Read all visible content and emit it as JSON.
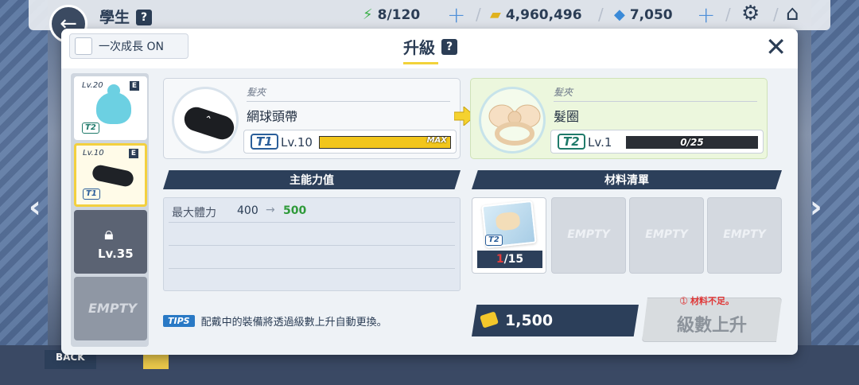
{
  "topbar": {
    "title": "學生",
    "help": "?",
    "ap": "8/120",
    "credits": "4,960,496",
    "gems": "7,050"
  },
  "modal": {
    "one_grow_label": "一次成長 ON",
    "title": "升級",
    "help": "?",
    "close": "✕"
  },
  "equipment_list": [
    {
      "level": "Lv.20",
      "grade": "E",
      "tier": "T2",
      "state": "normal"
    },
    {
      "level": "Lv.10",
      "grade": "E",
      "tier": "T1",
      "state": "selected"
    },
    {
      "level": "Lv.35",
      "state": "locked"
    },
    {
      "label": "EMPTY",
      "state": "empty"
    }
  ],
  "current_item": {
    "category": "髮夾",
    "name": "網球頭帶",
    "tier": "T1",
    "level": "Lv.10",
    "bar_label": "MAX",
    "progress": 1.0
  },
  "next_item": {
    "category": "髮夾",
    "name": "髮圈",
    "tier": "T2",
    "level": "Lv.1",
    "bar_label": "0/25",
    "progress": 0.0
  },
  "stats": {
    "header": "主能力值",
    "rows": [
      {
        "name": "最大體力",
        "from": "400",
        "arrow": "→",
        "to": "500"
      }
    ]
  },
  "materials": {
    "header": "材料清單",
    "slots": [
      {
        "tier": "T2",
        "have": "1",
        "need": "/15"
      },
      {
        "label": "EMPTY"
      },
      {
        "label": "EMPTY"
      },
      {
        "label": "EMPTY"
      }
    ]
  },
  "tips": {
    "badge": "TIPS",
    "text": "配戴中的裝備將透過級數上升自動更換。"
  },
  "cost": "1,500",
  "upgrade": {
    "warning": "➀ 材料不足。",
    "label": "級數上升"
  },
  "colors": {
    "navy": "#2c3f5a",
    "accent_yellow": "#f2c61c",
    "green_value": "#2f9a3a",
    "warning_red": "#e03434"
  }
}
